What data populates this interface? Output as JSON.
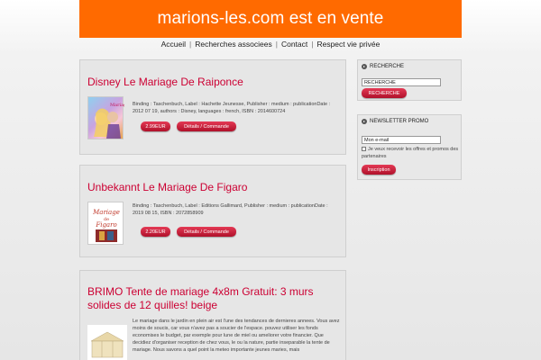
{
  "site": {
    "title": "marions-les.com est en vente"
  },
  "nav": {
    "items": [
      "Accueil",
      "Recherches associees",
      "Contact",
      "Respect vie privée"
    ],
    "separator": "|"
  },
  "products": [
    {
      "title": "Disney Le Mariage De Raiponce",
      "description": "Binding : Taschenbuch, Label : Hachette Jeunesse, Publisher : medium : publicationDate : 2012 07 19, authors : Disney, languages : french, ISBN : 2014600724",
      "price": "2.99EUR",
      "details_label": "Détails / Commande"
    },
    {
      "title": "Unbekannt Le Mariage De Figaro",
      "description": "Binding : Taschenbuch, Label : Editions Gallimard, Publisher : medium : publicationDate : 2019 08 15, ISBN : 2072858909",
      "price": "2.20EUR",
      "details_label": "Détails / Commande"
    },
    {
      "title": "BRIMO Tente de mariage 4x8m Gratuit: 3 murs solides de 12 quilles! beige",
      "description": "Le mariage dans le jardin en plein air est l'une des tendances de dernieres annees. Vous avez moins de soucis, car vous n'avez pas a soucier de l'espace. pouvez utiliser les fonds economises le budget, par exemple pour lune de miel ou ameliorer votre financier. Que decidiez d'organiser reception de chez vous, le ou la nature, partie inseparable la tente de mariage. Nous savons a quel point la meteo importante jeunes maries, mais"
    }
  ],
  "sidebar": {
    "search": {
      "heading": "RECHERCHE",
      "input_value": "RECHERCHE",
      "button_label": "RECHERCHE"
    },
    "newsletter": {
      "heading": "NEWSLETTER PROMO",
      "input_value": "Mon e-mail",
      "consent_text": "Je veux recevoir les offres et promos des partenaires",
      "button_label": "Inscription"
    }
  },
  "colors": {
    "header_bg": "#ff6a00",
    "title_color": "#cc0033",
    "button_color": "#c8203e"
  }
}
